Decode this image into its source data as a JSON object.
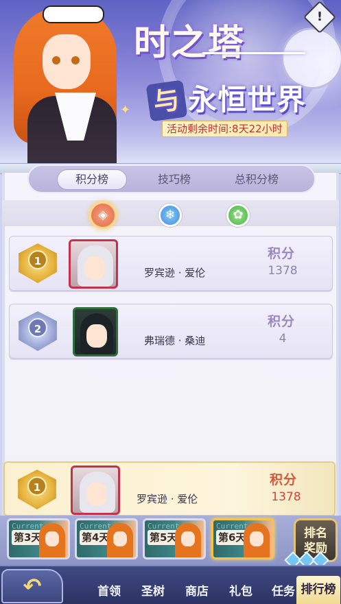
{
  "banner": {
    "title_main": "时之塔",
    "title_sub_char": "与",
    "title_sub_rest": "永恒世界",
    "timer": "活动剩余时间:8天22小时",
    "info_icon": "!"
  },
  "tabs": [
    {
      "label": "积分榜",
      "active": true
    },
    {
      "label": "技巧榜",
      "active": false
    },
    {
      "label": "总积分榜",
      "active": false
    }
  ],
  "elements": {
    "fire_icon": "◈",
    "water_icon": "❄",
    "wood_icon": "✿"
  },
  "ranking": [
    {
      "rank": "1",
      "name": "罗宾逊 · 爱伦",
      "score_label": "积分",
      "score": "1378"
    },
    {
      "rank": "2",
      "name": "弗瑞德 · 桑迪",
      "score_label": "积分",
      "score": "4"
    }
  ],
  "my_rank": {
    "rank": "1",
    "name": "罗宾逊 · 爱伦",
    "score_label": "积分",
    "score": "1378"
  },
  "days": [
    {
      "label": "第3天",
      "chalk": "Current",
      "current": false
    },
    {
      "label": "第4天",
      "chalk": "Current",
      "current": false
    },
    {
      "label": "第5天",
      "chalk": "Current",
      "current": false
    },
    {
      "label": "第6天",
      "chalk": "Current",
      "current": true
    }
  ],
  "reward_button": {
    "line1": "排名",
    "line2": "奖励"
  },
  "nav": {
    "back_icon": "↶",
    "items": [
      "首领",
      "圣树",
      "商店",
      "礼包",
      "任务",
      "排行榜"
    ]
  }
}
